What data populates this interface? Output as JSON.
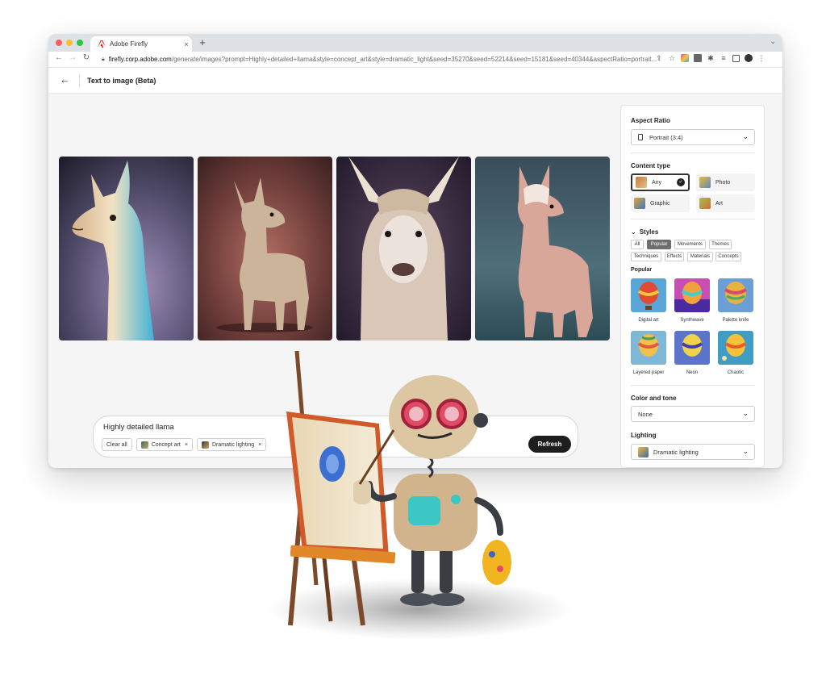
{
  "browser": {
    "tab_title": "Adobe Firefly",
    "tab_close": "×",
    "new_tab": "+",
    "url_host": "firefly.corp.adobe.com",
    "url_path": "/generate/images?prompt=Highly+detailed+llama&style=concept_art&style=dramatic_light&seed=35270&seed=52214&seed=15181&seed=40344&aspectRatio=portrait..."
  },
  "page": {
    "back_icon": "←",
    "title": "Text to image (Beta)"
  },
  "gallery": {
    "images": [
      {
        "name": "llama-1"
      },
      {
        "name": "llama-2"
      },
      {
        "name": "llama-3"
      },
      {
        "name": "llama-4"
      }
    ]
  },
  "prompt": {
    "text": "Highly detailed llama",
    "clear_all": "Clear all",
    "chips": [
      "Concept art",
      "Dramatic lighting"
    ],
    "chip_remove": "×",
    "refresh": "Refresh"
  },
  "panel": {
    "aspect_ratio_label": "Aspect Ratio",
    "aspect_ratio_value": "Portrait (3:4)",
    "content_type_label": "Content type",
    "content_types": [
      {
        "label": "Any",
        "selected": true
      },
      {
        "label": "Photo",
        "selected": false
      },
      {
        "label": "Graphic",
        "selected": false
      },
      {
        "label": "Art",
        "selected": false
      }
    ],
    "styles_label": "Styles",
    "style_tabs": [
      "All",
      "Popular",
      "Movements",
      "Themes",
      "Techniques",
      "Effects",
      "Materials",
      "Concepts"
    ],
    "active_style_tab": "Popular",
    "popular_label": "Popular",
    "popular_styles": [
      "Digital art",
      "Synthwave",
      "Palette knife",
      "Layered paper",
      "Neon",
      "Chaotic"
    ],
    "color_tone_label": "Color and tone",
    "color_tone_value": "None",
    "lighting_label": "Lighting",
    "lighting_value": "Dramatic lighting"
  },
  "colors": {
    "accent_dark": "#1e1e1e",
    "adobe_red": "#eb1000"
  }
}
